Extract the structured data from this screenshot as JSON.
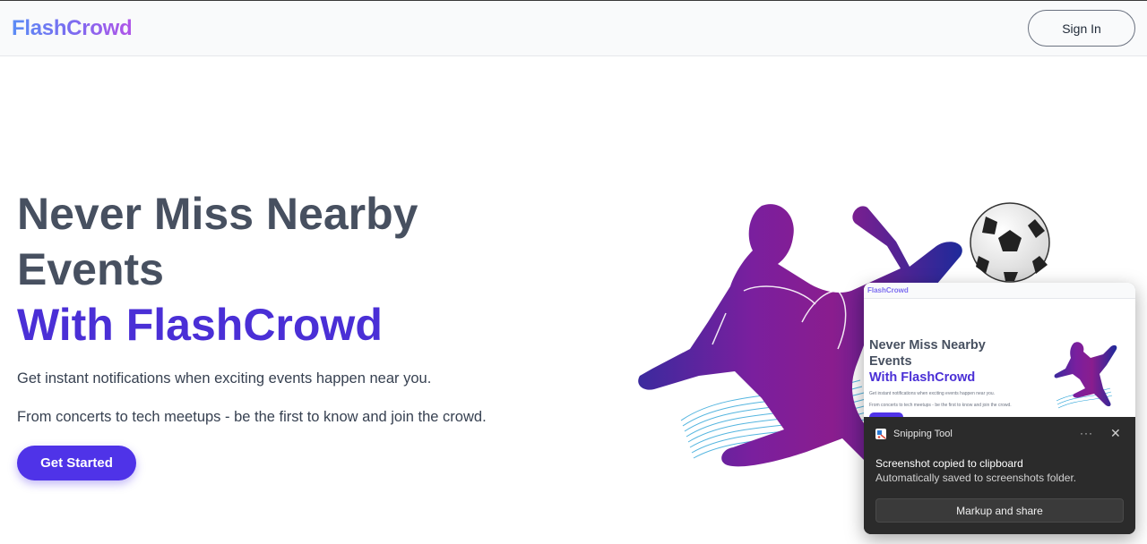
{
  "navbar": {
    "logo": "FlashCrowd",
    "signin_label": "Sign In"
  },
  "hero": {
    "title_line1": "Never Miss Nearby",
    "title_line2": "Events",
    "title_line3": "With FlashCrowd",
    "paragraph1": "Get instant notifications when exciting events happen near you.",
    "paragraph2": "From concerts to tech meetups - be the first to know and join the crowd.",
    "cta_label": "Get Started"
  },
  "toast": {
    "app_name": "Snipping Tool",
    "more_label": "···",
    "close_label": "✕",
    "message_title": "Screenshot copied to clipboard",
    "message_body": "Automatically saved to screenshots folder.",
    "action_label": "Markup and share",
    "preview": {
      "logo": "FlashCrowd",
      "title_line1": "Never Miss Nearby",
      "title_line2": "Events",
      "title_line3": "With FlashCrowd",
      "paragraph1": "Get instant notifications when exciting events happen near you.",
      "paragraph2": "From concerts to tech meetups - be the first to know and join the crowd."
    }
  },
  "colors": {
    "accent": "#4f33e8",
    "title": "#475060",
    "brand_gradient_start": "#5b8cf5",
    "brand_gradient_end": "#b054e8"
  },
  "icons": [
    "soccer-player-illustration",
    "soccer-ball-icon",
    "snipping-tool-icon",
    "more-icon",
    "close-icon"
  ]
}
